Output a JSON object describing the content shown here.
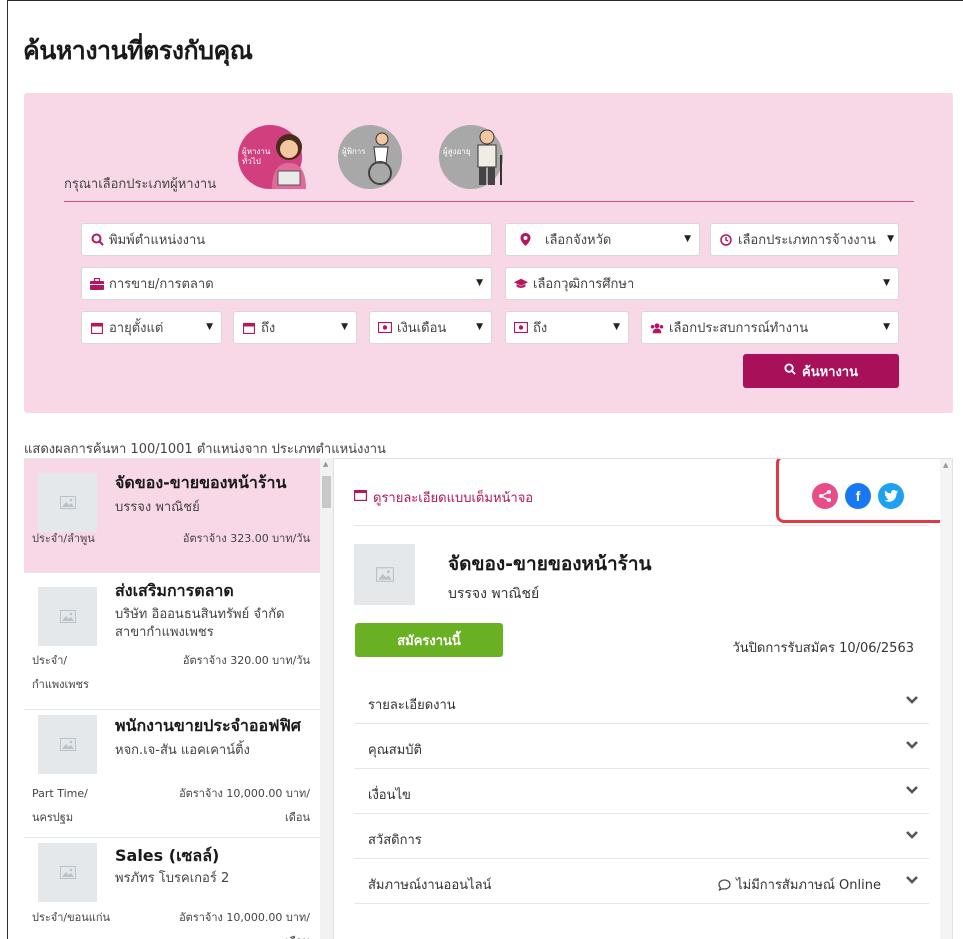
{
  "page": {
    "title": "ค้นหางานที่ตรงกับคุณ"
  },
  "search": {
    "type_label": "กรุณาเลือกประเภทผู้หางาน",
    "types": [
      {
        "label": "ผู้หางานทั่วไป",
        "selected": true
      },
      {
        "label": "ผู้พิการ",
        "selected": false
      },
      {
        "label": "ผู้สูงอายุ",
        "selected": false
      }
    ],
    "position_placeholder": "พิมพ์ตำแหน่งงาน",
    "province": "เลือกจังหวัด",
    "employment_type": "เลือกประเภทการจ้างงาน",
    "job_category": "การขาย/การตลาด",
    "education": "เลือกวุฒิการศึกษา",
    "age_from": "อายุตั้งแต่",
    "age_to": "ถึง",
    "salary_from": "เงินเดือน",
    "salary_to": "ถึง",
    "experience": "เลือกประสบการณ์ทำงาน",
    "search_button": "ค้นหางาน"
  },
  "results": {
    "summary": "แสดงผลการค้นหา 100/1001 ตำแหน่งจาก ประเภทตำแหน่งงาน",
    "jobs": [
      {
        "title": "จัดของ-ขายของหน้าร้าน",
        "company": "บรรจง พาณิชย์",
        "type": "ประจำ/ลำพูน",
        "rate": "อัตราจ้าง 323.00 บาท/วัน"
      },
      {
        "title": "ส่งเสริมการตลาด",
        "company": "บริษัท อิออนธนสินทรัพย์ จำกัด สาขากำแพงเพชร",
        "type": "ประจำ/",
        "type2": "กำแพงเพชร",
        "rate": "อัตราจ้าง 320.00 บาท/วัน"
      },
      {
        "title": "พนักงานขายประจำออฟฟิศ",
        "company": "หจก.เจ-สัน แอคเคาน์ติ้ง",
        "type": "Part Time/",
        "type2": "นครปฐม",
        "rate": "อัตราจ้าง 10,000.00 บาท/",
        "rate2": "เดือน"
      },
      {
        "title": "Sales (เซลล์)",
        "company": "พรภัทร โบรคเกอร์ 2",
        "type": "ประจำ/ขอนแก่น",
        "rate": "อัตราจ้าง 10,000.00 บาท/",
        "rate2": "เดือน"
      }
    ]
  },
  "detail": {
    "fullscreen_link": "ดูรายละเอียดแบบเต็มหน้าจอ",
    "title": "จัดของ-ขายของหน้าร้าน",
    "company": "บรรจง พาณิชย์",
    "apply_button": "สมัครงานนี้",
    "closing_date": "วันปิดการรับสมัคร 10/06/2563",
    "sections": [
      "รายละเอียดงาน",
      "คุณสมบัติ",
      "เงื่อนไข",
      "สวัสดิการ",
      "สัมภาษณ์งานออนไลน์"
    ],
    "online_interview_status": "ไม่มีการสัมภาษณ์ Online"
  },
  "colors": {
    "accent": "#a8105a",
    "panel": "#f8d7e6",
    "apply": "#6ab023",
    "facebook": "#1877f2",
    "twitter": "#1da1f2",
    "share": "#e84d8a",
    "highlight": "#e03a45"
  }
}
